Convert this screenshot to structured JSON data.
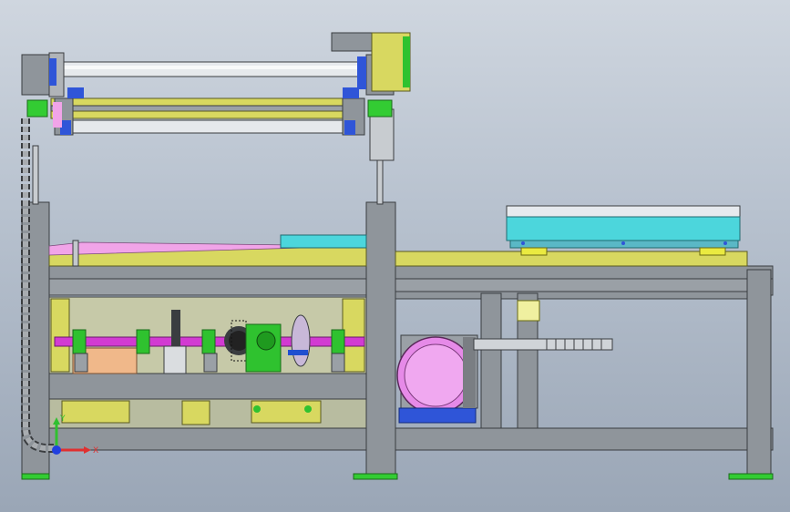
{
  "viewport": {
    "background_top": "#cfd6df",
    "background_bottom": "#9aa6b6"
  },
  "colors": {
    "frame_steel": "#8f959b",
    "frame_edge": "#3a3d40",
    "motor_pink": "#e68ae8",
    "shaft_magenta": "#d23bd2",
    "plate_yellow": "#d8d860",
    "gear_green": "#2fc22f",
    "bearing_blue": "#2f55d8",
    "hopper_cyan": "#4cd6dc",
    "tray_pink": "#f1a4e8",
    "foot_green": "#33cc33",
    "accent_orange": "#f0a060"
  },
  "axis_triad": {
    "x_label": "X",
    "y_label": "Y",
    "x_color": "#e03030",
    "y_color": "#30c030",
    "origin_color": "#2040e0"
  }
}
